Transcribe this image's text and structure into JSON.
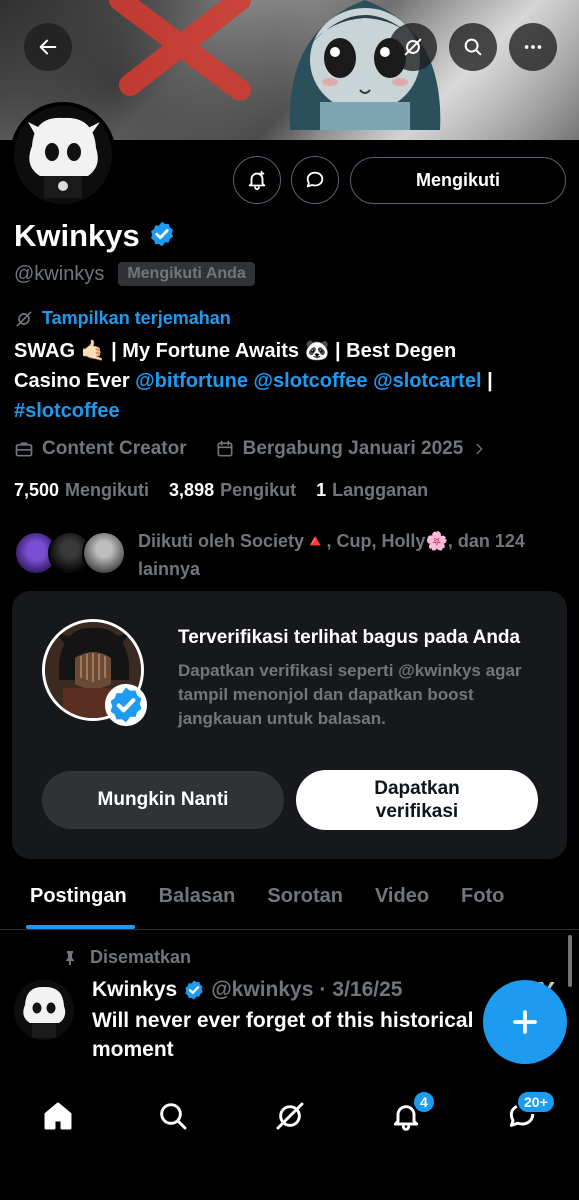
{
  "header": {
    "back_icon": "arrow-left-icon",
    "grok_icon": "grok-icon",
    "search_icon": "search-icon",
    "more_icon": "more-horizontal-icon"
  },
  "profile": {
    "name": "Kwinkys",
    "handle": "@kwinkys",
    "follows_you_badge": "Mengikuti Anda",
    "follow_button": "Mengikuti",
    "translate_link": "Tampilkan terjemahan",
    "bio": {
      "line1_a": "SWAG 🤙🏻 | My Fortune Awaits 🐼 | Best Degen",
      "line2_a": "Casino Ever ",
      "mention1": "@bitfortune",
      "mention2": "@slotcoffee",
      "mention3": "@slotcartel",
      "line2_end": " |",
      "hashtag": "#slotcoffee"
    },
    "category": "Content Creator",
    "joined": "Bergabung Januari 2025",
    "stats": [
      {
        "num": "7,500",
        "label": "Mengikuti"
      },
      {
        "num": "3,898",
        "label": "Pengikut"
      },
      {
        "num": "1",
        "label": "Langganan"
      }
    ],
    "followed_by": "Diikuti oleh Society🔺, Cup, Holly🌸, dan 124 lainnya"
  },
  "verify_card": {
    "title": "Terverifikasi terlihat bagus pada Anda",
    "description": "Dapatkan verifikasi seperti @kwinkys agar tampil menonjol dan dapatkan boost jangkauan untuk balasan.",
    "later_button": "Mungkin Nanti",
    "verify_button": "Dapatkan verifikasi"
  },
  "tabs": [
    {
      "label": "Postingan",
      "active": true
    },
    {
      "label": "Balasan"
    },
    {
      "label": "Sorotan"
    },
    {
      "label": "Video"
    },
    {
      "label": "Foto"
    }
  ],
  "pinned_post": {
    "pinned_label": "Disematkan",
    "author": "Kwinkys",
    "handle": "@kwinkys",
    "separator": "·",
    "date": "3/16/25",
    "text": "Will never ever forget of this historical moment",
    "x_logo": "X"
  },
  "bottom_nav": {
    "notifications_badge": "4",
    "messages_badge": "20+"
  },
  "colors": {
    "accent": "#1d9bf0",
    "muted": "#71767b",
    "card": "#16181c"
  }
}
